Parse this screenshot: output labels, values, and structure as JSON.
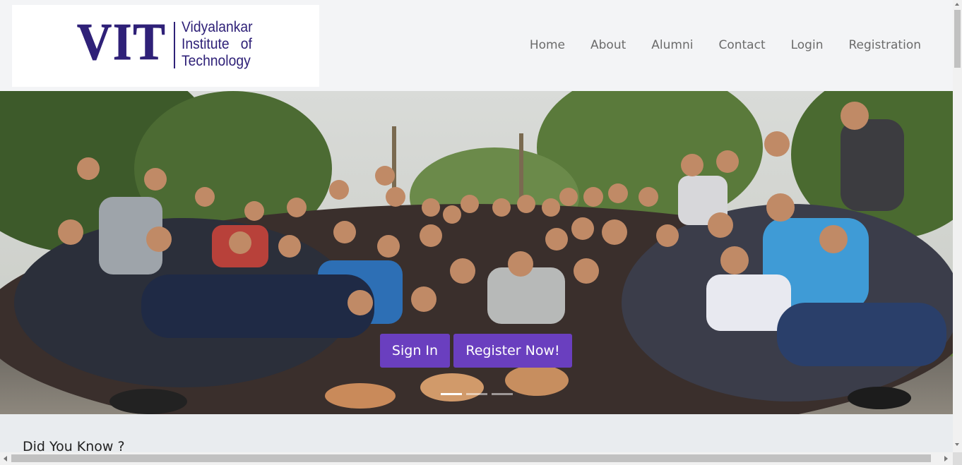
{
  "logo": {
    "mark": "VIT",
    "lines": [
      "Vidyalankar",
      "Institute   of",
      "Technology"
    ]
  },
  "nav": {
    "items": [
      "Home",
      "About",
      "Alumni",
      "Contact",
      "Login",
      "Registration"
    ]
  },
  "hero": {
    "image": "group-photo",
    "signin_label": "Sign In",
    "register_label": "Register Now!",
    "slides": 3,
    "active_slide": 1
  },
  "section": {
    "title": "Did You Know ?"
  },
  "colors": {
    "brand": "#2f2178",
    "button": "#6a3fbf",
    "nav_text": "#6b6b6b"
  }
}
